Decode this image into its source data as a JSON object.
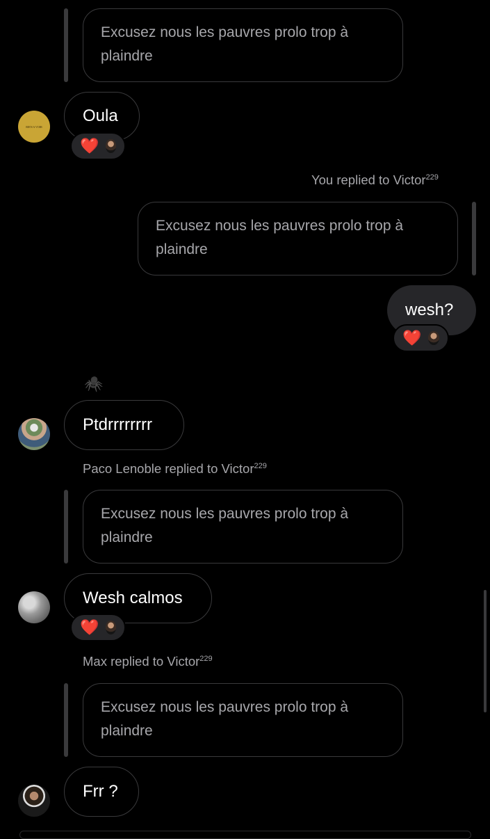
{
  "messages": {
    "quote_1": {
      "text": "Excusez nous les pauvres prolo trop à plaindre"
    },
    "msg_oula": {
      "text": "Oula",
      "reaction": "❤️"
    },
    "reply_label_you": {
      "prefix": "You replied to Victor",
      "sup": "229"
    },
    "quote_2": {
      "text": "Excusez nous les pauvres prolo trop à plaindre"
    },
    "msg_wesh": {
      "text": "wesh?",
      "reaction": "❤️"
    },
    "spider": "🕷️",
    "msg_ptdr": {
      "text": "Ptdrrrrrrrr"
    },
    "reply_label_paco": {
      "prefix": "Paco Lenoble replied to Victor",
      "sup": "229"
    },
    "quote_3": {
      "text": "Excusez nous les pauvres prolo trop à plaindre"
    },
    "msg_calmos": {
      "text": "Wesh calmos",
      "reaction": "❤️"
    },
    "reply_label_max": {
      "prefix": "Max replied to Victor",
      "sup": "229"
    },
    "quote_4": {
      "text": "Excusez nous les pauvres prolo trop à plaindre"
    },
    "msg_frr": {
      "text": "Frr ?"
    }
  },
  "avatars": {
    "oula_logo_text": "RIEN A VOIR"
  },
  "colors": {
    "background": "#000000",
    "bubble_border": "#3a3a3c",
    "my_bubble": "#262629",
    "meta_text": "#a7a7ab",
    "gold_avatar": "#c9a535"
  }
}
